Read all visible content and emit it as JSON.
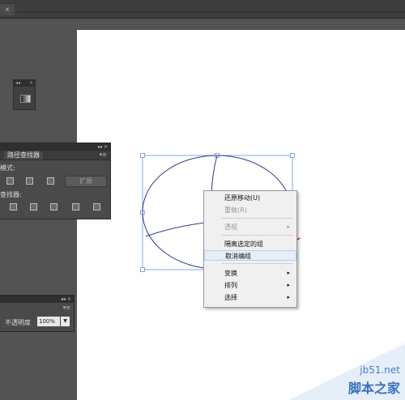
{
  "topbar": {
    "close_glyph": "×"
  },
  "mini_panel": {
    "controls": "◂◂ ×",
    "icon": "gradient-icon"
  },
  "pathfinder_panel": {
    "controls": "◂◂ ×",
    "tab_label": "路径查找器",
    "menu_glyph": "▾≡",
    "shape_modes_label": "模式:",
    "pathfinders_label": "查找器:",
    "expand_label": "扩展"
  },
  "transparency_panel": {
    "controls": "◂◂ ×",
    "menu_glyph": "▾≡",
    "opacity_label": "不透明度",
    "opacity_value": "100%",
    "dropdown_glyph": "▼"
  },
  "context_menu": {
    "items": [
      {
        "label": "还原移动(U)",
        "disabled": false,
        "submenu": false
      },
      {
        "label": "重做(R)",
        "disabled": true,
        "submenu": false
      },
      {
        "label": "透视",
        "disabled": true,
        "submenu": true
      },
      {
        "label": "隔离选定的组",
        "disabled": false,
        "submenu": false
      },
      {
        "label": "取消编组",
        "disabled": false,
        "submenu": false,
        "highlighted": true
      },
      {
        "label": "变换",
        "disabled": false,
        "submenu": true
      },
      {
        "label": "排列",
        "disabled": false,
        "submenu": true
      },
      {
        "label": "选择",
        "disabled": false,
        "submenu": true
      }
    ],
    "submenu_glyph": "▸"
  },
  "watermark": {
    "line1": "jb51.net",
    "line2": "脚本之家"
  },
  "colors": {
    "path_stroke": "#2b3a8f",
    "selection": "#6a8fd8",
    "arrow": "#e21b1b"
  }
}
